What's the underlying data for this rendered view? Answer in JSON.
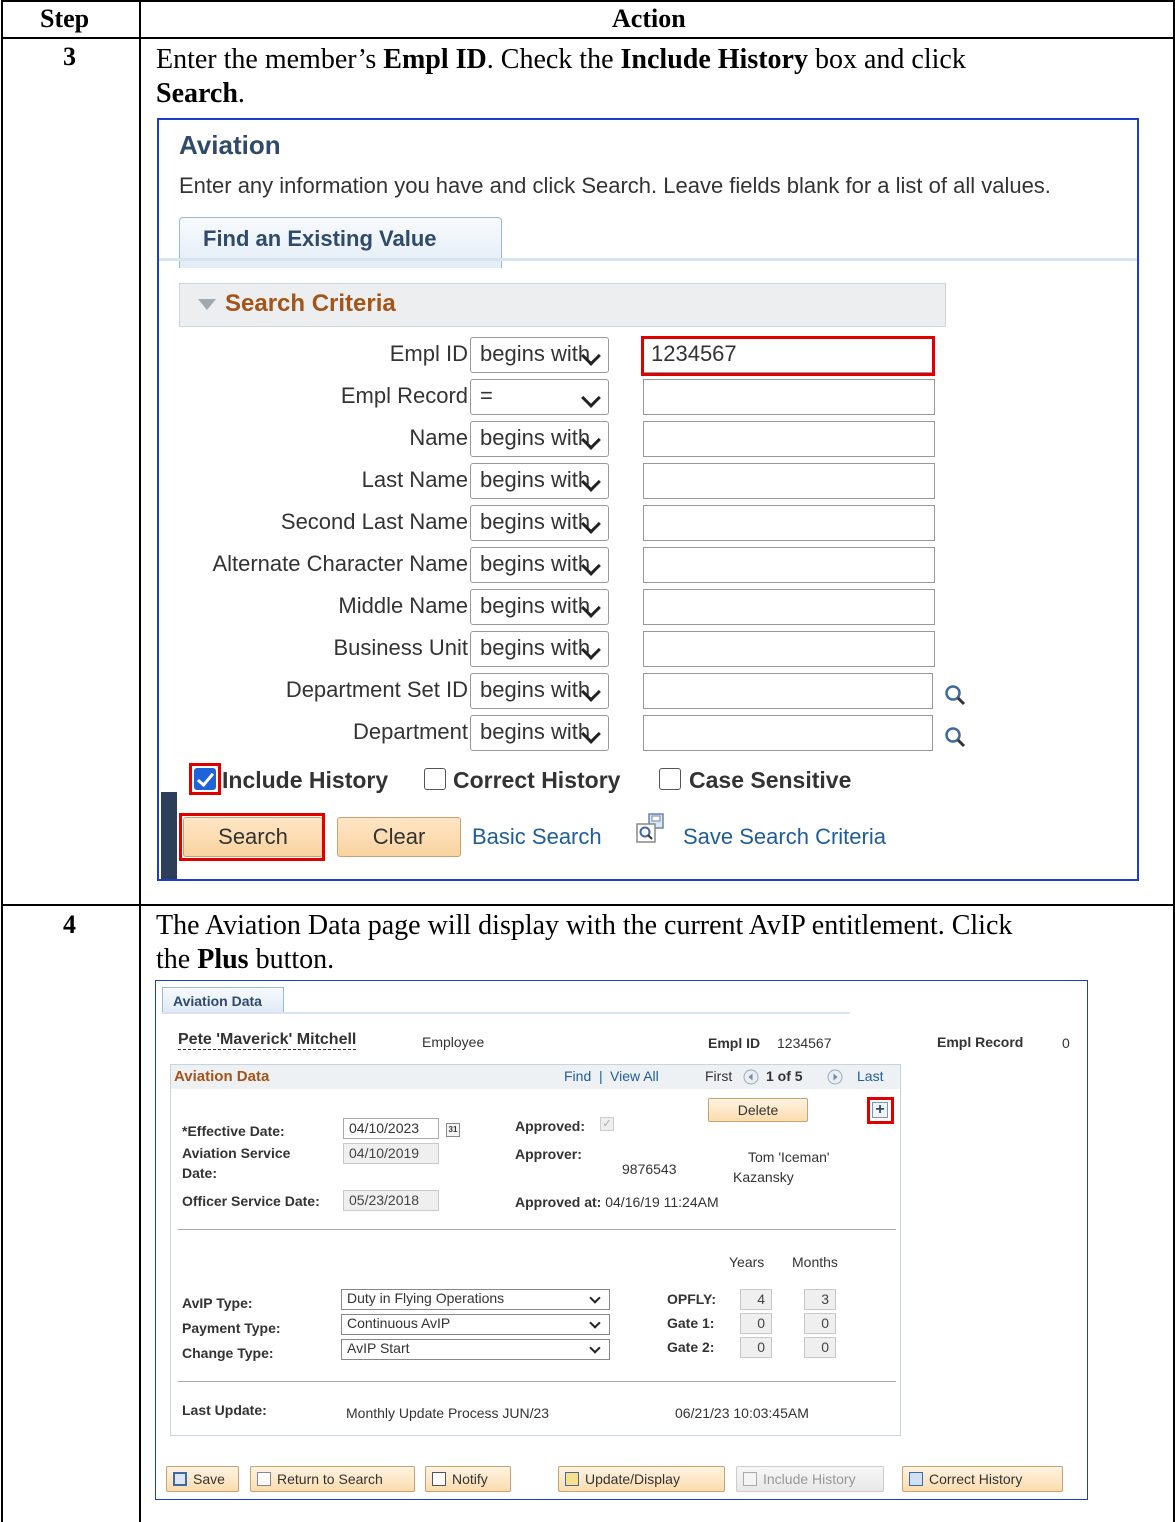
{
  "table": {
    "col_step": "Step",
    "col_action": "Action",
    "rows": [
      {
        "step": "3",
        "instr_l1a": "Enter the member’s ",
        "instr_l1b": "Empl ID",
        "instr_l1c": ". Check the ",
        "instr_l1d": "Include History",
        "instr_l1e": " box and click",
        "instr_l2a": "Search",
        "instr_l2b": "."
      },
      {
        "step": "4",
        "instr_l1": "The Aviation Data page will display with the current AvIP entitlement. Click",
        "instr_l2a": "the ",
        "instr_l2b": "Plus",
        "instr_l2c": " button."
      }
    ]
  },
  "search_page": {
    "title": "Aviation",
    "subtitle": "Enter any information you have and click Search. Leave fields blank for a list of all values.",
    "tab": "Find an Existing Value",
    "section": "Search Criteria",
    "fields": [
      {
        "label": "Empl ID",
        "operator": "begins with",
        "value": "1234567"
      },
      {
        "label": "Empl Record",
        "operator": "=",
        "value": ""
      },
      {
        "label": "Name",
        "operator": "begins with",
        "value": ""
      },
      {
        "label": "Last Name",
        "operator": "begins with",
        "value": ""
      },
      {
        "label": "Second Last Name",
        "operator": "begins with",
        "value": ""
      },
      {
        "label": "Alternate Character Name",
        "operator": "begins with",
        "value": ""
      },
      {
        "label": "Middle Name",
        "operator": "begins with",
        "value": ""
      },
      {
        "label": "Business Unit",
        "operator": "begins with",
        "value": ""
      },
      {
        "label": "Department Set ID",
        "operator": "begins with",
        "value": ""
      },
      {
        "label": "Department",
        "operator": "begins with",
        "value": ""
      }
    ],
    "checkboxes": {
      "include_history": {
        "label": "Include History",
        "checked": true
      },
      "correct_history": {
        "label": "Correct History",
        "checked": false
      },
      "case_sensitive": {
        "label": "Case Sensitive",
        "checked": false
      }
    },
    "buttons": {
      "search": "Search",
      "clear": "Clear"
    },
    "links": {
      "basic_search": "Basic Search",
      "save_criteria": "Save Search Criteria"
    }
  },
  "data_page": {
    "tab": "Aviation Data",
    "name": "Pete 'Maverick' Mitchell",
    "person_type": "Employee",
    "empl_id_label": "Empl ID",
    "empl_id": "1234567",
    "empl_record_label": "Empl Record",
    "empl_record": "0",
    "section": "Aviation Data",
    "nav": {
      "find": "Find",
      "sep": "|",
      "view_all": "View All",
      "first": "First",
      "position": "1 of 5",
      "last": "Last"
    },
    "delete_label": "Delete",
    "effective_date_label": "*Effective Date:",
    "effective_date": "04/10/2023",
    "aviation_service_label_1": "Aviation Service",
    "aviation_service_label_2": "Date:",
    "aviation_service_date": "04/10/2019",
    "officer_service_label": "Officer Service Date:",
    "officer_service_date": "05/23/2018",
    "approved_label": "Approved:",
    "approver_label": "Approver:",
    "approver_id": "9876543",
    "approver_name_1": "Tom 'Iceman'",
    "approver_name_2": "Kazansky",
    "approved_at_label": "Approved at:",
    "approved_at": "04/16/19 11:24AM",
    "years_label": "Years",
    "months_label": "Months",
    "avip_type_label": "AvIP Type:",
    "avip_type": "Duty in Flying Operations",
    "payment_type_label": "Payment Type:",
    "payment_type": "Continuous AvIP",
    "change_type_label": "Change Type:",
    "change_type": "AvIP Start",
    "opfly_label": "OPFLY:",
    "gate1_label": "Gate 1:",
    "gate2_label": "Gate 2:",
    "opfly": {
      "years": "4",
      "months": "3"
    },
    "gate1": {
      "years": "0",
      "months": "0"
    },
    "gate2": {
      "years": "0",
      "months": "0"
    },
    "last_update_label": "Last Update:",
    "last_update_process": "Monthly Update Process JUN/23",
    "last_update_time": "06/21/23 10:03:45AM",
    "buttons": {
      "save": "Save",
      "return": "Return to Search",
      "notify": "Notify",
      "update": "Update/Display",
      "include_history": "Include History",
      "correct_history": "Correct History"
    }
  },
  "colors": {
    "highlight": "#e00000",
    "frame": "#1a3ec8",
    "section_title": "#a35419",
    "link": "#1f5d9a"
  }
}
